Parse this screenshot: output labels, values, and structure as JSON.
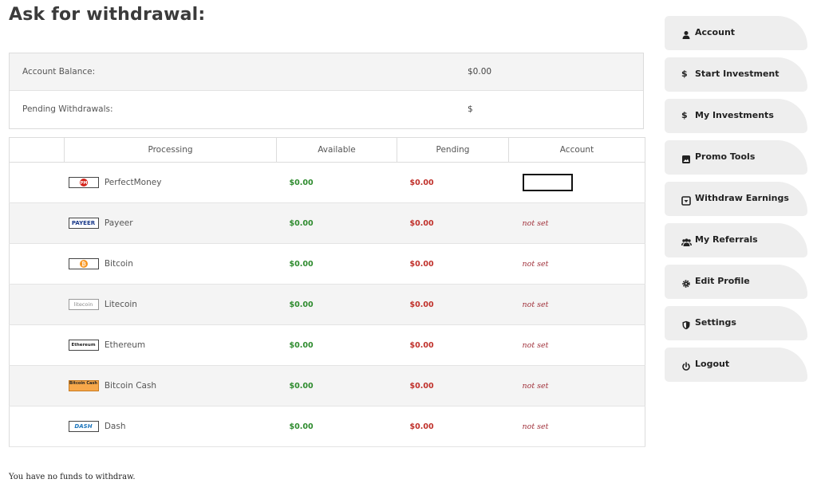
{
  "page_title": "Ask for withdrawal:",
  "balance": {
    "account_balance_label": "Account Balance:",
    "account_balance_value": "$0.00",
    "pending_withdrawals_label": "Pending Withdrawals:",
    "pending_withdrawals_value": "$"
  },
  "table": {
    "headers": [
      "",
      "Processing",
      "Available",
      "Pending",
      "Account"
    ],
    "rows": [
      {
        "name": "PerfectMoney",
        "logo": "PM",
        "available": "$0.00",
        "pending": "$0.00",
        "account": ""
      },
      {
        "name": "Payeer",
        "logo": "PAYEER",
        "available": "$0.00",
        "pending": "$0.00",
        "account": "not set"
      },
      {
        "name": "Bitcoin",
        "logo": "₿",
        "available": "$0.00",
        "pending": "$0.00",
        "account": "not set"
      },
      {
        "name": "Litecoin",
        "logo": "litecoin",
        "available": "$0.00",
        "pending": "$0.00",
        "account": "not set"
      },
      {
        "name": "Ethereum",
        "logo": "Ethereum",
        "available": "$0.00",
        "pending": "$0.00",
        "account": "not set"
      },
      {
        "name": "Bitcoin Cash",
        "logo": "Bitcoin Cash",
        "available": "$0.00",
        "pending": "$0.00",
        "account": "not set"
      },
      {
        "name": "Dash",
        "logo": "DASH",
        "available": "$0.00",
        "pending": "$0.00",
        "account": "not set"
      }
    ]
  },
  "footer_note": "You have no funds to withdraw.",
  "menu": {
    "items": [
      {
        "label": "Account",
        "icon": "user-icon"
      },
      {
        "label": "Start Investment",
        "icon": "dollar-icon"
      },
      {
        "label": "My Investments",
        "icon": "dollar-icon"
      },
      {
        "label": "Promo Tools",
        "icon": "image-icon"
      },
      {
        "label": "Withdraw Earnings",
        "icon": "download-box-icon"
      },
      {
        "label": "My Referrals",
        "icon": "users-icon"
      },
      {
        "label": "Edit Profile",
        "icon": "gear-icon"
      },
      {
        "label": "Settings",
        "icon": "shield-icon"
      },
      {
        "label": "Logout",
        "icon": "power-icon"
      }
    ]
  },
  "colors": {
    "available_green": "#2e8b2e",
    "pending_red": "#c0302a",
    "not_set": "#a0303a",
    "menu_bg": "#eeeeee"
  }
}
